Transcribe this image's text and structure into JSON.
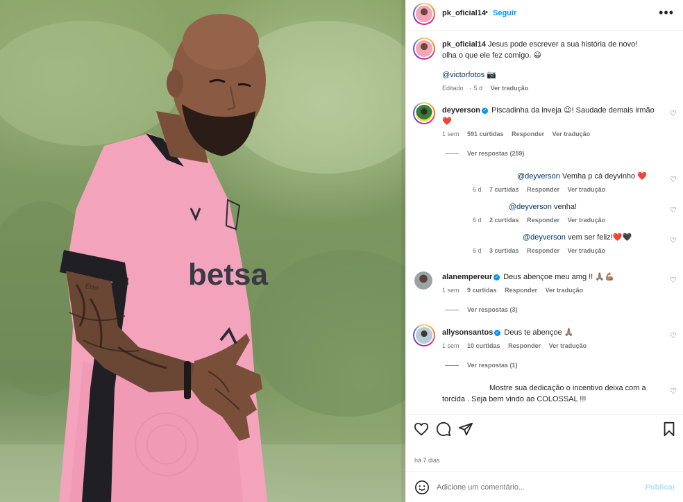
{
  "post": {
    "username": "pk_oficial14",
    "follow_label": "Seguir",
    "separator": "•",
    "more_label": "•••",
    "caption_line1": "Jesus pode escrever a sua história de novo!",
    "caption_line2": "olha o que ele fez comigo. 😃",
    "caption_mention": "@victorfotos",
    "caption_emoji": "📷",
    "caption_edited": "Editado",
    "caption_time": "5 d",
    "caption_translate": "Ver tradução",
    "date": "há 7 dias"
  },
  "photo": {
    "shirt_text": "betsa",
    "tattoo_text": "Esta"
  },
  "comments": [
    {
      "username": "deyverson",
      "text": "Piscadinha da inveja 😉! Saudade demais irmão",
      "emoji": "❤️",
      "time": "1 sem",
      "likes": "591 curtidas",
      "reply": "Responder",
      "translate": "Ver tradução",
      "view_replies": "Ver respostas (259)"
    },
    {
      "username": "alanempereur",
      "text": "Deus abençoe meu amg !! 🙏🏽💪🏽",
      "time": "1 sem",
      "likes": "9 curtidas",
      "reply": "Responder",
      "translate": "Ver tradução",
      "view_replies": "Ver respostas (3)"
    },
    {
      "username": "allysonsantos",
      "text": "Deus te abençoe 🙏🏽",
      "time": "1 sem",
      "likes": "10 curtidas",
      "reply": "Responder",
      "translate": "Ver tradução",
      "view_replies": "Ver respostas (1)"
    }
  ],
  "replies": [
    {
      "mention": "@deyverson",
      "text": "Vemha p cá deyvinho",
      "emoji": "❤️",
      "time": "6 d",
      "likes": "7 curtidas",
      "reply": "Responder",
      "translate": "Ver tradução"
    },
    {
      "mention": "@deyverson",
      "text": "venha!",
      "time": "6 d",
      "likes": "2 curtidas",
      "reply": "Responder",
      "translate": "Ver tradução"
    },
    {
      "mention": "@deyverson",
      "text": "vem ser feliz!",
      "emoji": "❤️🖤",
      "time": "6 d",
      "likes": "3 curtidas",
      "reply": "Responder",
      "translate": "Ver tradução"
    }
  ],
  "last_comment": {
    "text_line1": "Mostre sua dedicação o incentivo deixa com a",
    "text_line2": "torcida . Seja bem vindo ao COLOSSAL !!!"
  },
  "add_comment": {
    "placeholder": "Adicione um comentário...",
    "publish_label": "Publicar"
  },
  "colors": {
    "accent": "#0095f6",
    "shirt": "#f4a3bd",
    "heart": "#e0245e"
  },
  "icons": {
    "like": "heart-outline-icon",
    "comment": "speech-bubble-icon",
    "share": "paper-plane-icon",
    "save": "bookmark-icon",
    "emoji": "smiley-icon",
    "more": "ellipsis-icon"
  }
}
